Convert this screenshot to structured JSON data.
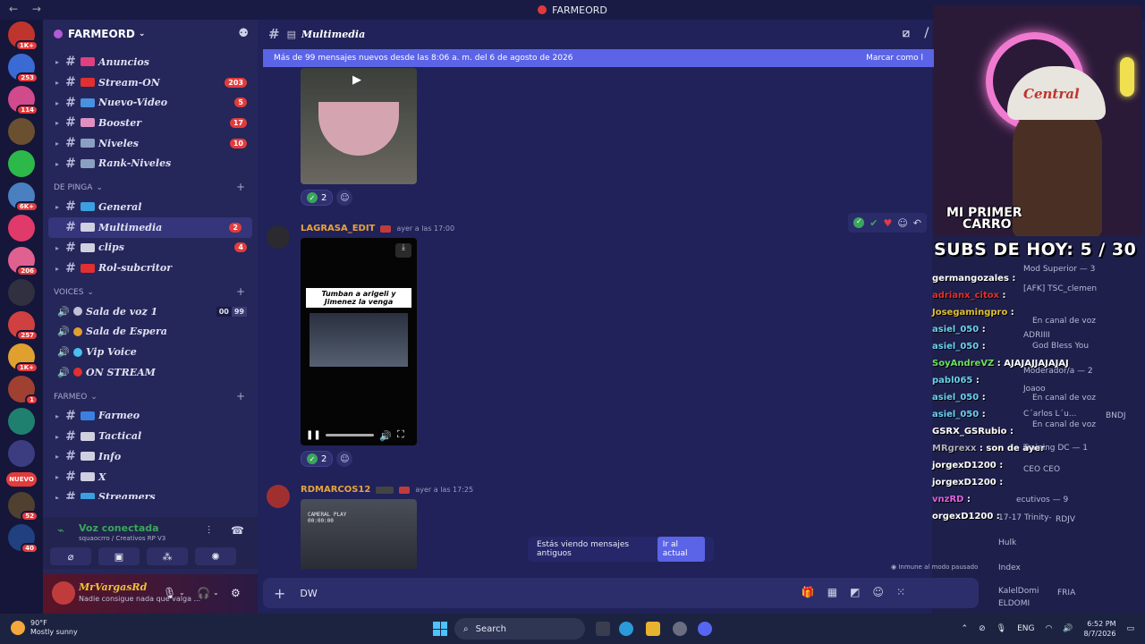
{
  "window": {
    "title": "FARMEORD"
  },
  "servers": [
    {
      "badge": "1K+",
      "color": "#c0342e"
    },
    {
      "badge": "253",
      "color": "#3a6ad4"
    },
    {
      "badge": "114",
      "color": "#d04a8c"
    },
    {
      "badge": "",
      "color": "#6a5030"
    },
    {
      "badge": "",
      "color": "#2db84a"
    },
    {
      "badge": "6K+",
      "color": "#4a80c0"
    },
    {
      "badge": "",
      "color": "#e03a6a"
    },
    {
      "badge": "206",
      "color": "#e06090"
    },
    {
      "badge": "",
      "color": "#303040"
    },
    {
      "badge": "257",
      "color": "#d04040"
    },
    {
      "badge": "1K+",
      "color": "#e0a030"
    },
    {
      "badge": "1",
      "color": "#a04030"
    },
    {
      "badge": "",
      "color": "#208070"
    },
    {
      "badge": "",
      "color": "#3c3d80"
    },
    {
      "badge": "52",
      "color": "#504030"
    },
    {
      "badge": "40",
      "color": "#204080"
    }
  ],
  "new_badge": "NUEVO",
  "guild": {
    "name": "FARMEORD"
  },
  "channels_top": [
    {
      "name": "Anuncios",
      "count": "",
      "emo": "#e04080"
    },
    {
      "name": "Stream-ON",
      "count": "203",
      "emo": "#e03030"
    },
    {
      "name": "Nuevo-Video",
      "count": "5",
      "emo": "#4a90e0"
    },
    {
      "name": "Booster",
      "count": "17",
      "emo": "#e090c0"
    },
    {
      "name": "Niveles",
      "count": "10",
      "emo": "#8aa0c0"
    },
    {
      "name": "Rank-Niveles",
      "count": "",
      "emo": "#8aa0c0"
    }
  ],
  "categories": {
    "de_pinga": "DE PINGA",
    "voices": "VOICES",
    "farmeo": "FARMEO"
  },
  "channels_pinga": [
    {
      "name": "General",
      "count": "",
      "emo": "#3aa0e0"
    },
    {
      "name": "Multimedia",
      "count": "2",
      "emo": "#d0d0e0"
    },
    {
      "name": "clips",
      "count": "4",
      "emo": "#d0d0e0"
    },
    {
      "name": "Rol-subcritor",
      "count": "",
      "emo": "#e03030"
    }
  ],
  "channels_voice": [
    {
      "name": "Sala de voz 1",
      "user_count": "00",
      "user_limit": "99"
    },
    {
      "name": "Sala de Espera"
    },
    {
      "name": "Vip Voice"
    },
    {
      "name": "ON STREAM"
    }
  ],
  "channels_farmeo": [
    {
      "name": "Farmeo",
      "emo": "#3a80e0"
    },
    {
      "name": "Tactical",
      "emo": "#d0d0e0"
    },
    {
      "name": "Info",
      "emo": "#d0d0e0"
    },
    {
      "name": "X",
      "emo": "#d0d0e0"
    },
    {
      "name": "Streamers",
      "emo": "#3aa0e0"
    }
  ],
  "voice_connected": {
    "title": "Voz conectada",
    "subtitle": "squaocrro / Creativos RP V3"
  },
  "user": {
    "name": "MrVargasRd",
    "status": "Nadie consigue nada que valga ..."
  },
  "channel_header": {
    "name": "Multimedia"
  },
  "new_messages_bar": {
    "text": "Más de 99 mensajes nuevos desde las 8:06 a. m. del 6 de agosto de 2026",
    "action": "Marcar como l"
  },
  "messages": [
    {
      "author": "",
      "reaction_count": "2"
    },
    {
      "author": "LAGRASA_EDIT",
      "time": "ayer a las 17:00",
      "video_caption": "Tumban a arigeli y Jimenez la venga",
      "reaction_count": "2"
    },
    {
      "author": "RDMARCOS12",
      "time": "ayer a las 17:25",
      "video_caption": "CAMERAL PLAY 00:00:00"
    }
  ],
  "old_messages_toast": {
    "text": "Estás viendo mensajes antiguos",
    "button": "Ir al actual"
  },
  "paused_note": "Inmune al modo pausado",
  "composer": {
    "value": "DW"
  },
  "stream_overlay": {
    "cap_text": "Central",
    "car_text_1": "MI PRIMER",
    "car_text_2": "CARRO",
    "subs_text": "SUBS DE HOY: 5 / 30"
  },
  "chat_lines": [
    {
      "user": "germangozales",
      "text": "",
      "color": "#ffffff"
    },
    {
      "user": "adrianx_citox",
      "text": "",
      "color": "#e03030"
    },
    {
      "user": "Josegamingpro",
      "text": "",
      "color": "#e0c030"
    },
    {
      "user": "asiel_050",
      "text": "",
      "color": "#6ad0f0"
    },
    {
      "user": "asiel_050",
      "text": "",
      "color": "#6ad0f0"
    },
    {
      "user": "SoyAndreVZ",
      "text": "AJAJAJJAJAJAJ",
      "color": "#6ae060"
    },
    {
      "user": "pabl065",
      "text": "",
      "color": "#6ad0f0"
    },
    {
      "user": "asiel_050",
      "text": "",
      "color": "#6ad0f0"
    },
    {
      "user": "asiel_050",
      "text": "",
      "color": "#6ad0f0"
    },
    {
      "user": "GSRX_GSRubio",
      "text": "",
      "color": "#ffffff"
    },
    {
      "user": "MRgrexx",
      "text": "son de ayer",
      "color": "#b0b0c0"
    },
    {
      "user": "jorgexD1200",
      "text": "",
      "color": "#ffffff"
    },
    {
      "user": "jorgexD1200",
      "text": "",
      "color": "#ffffff"
    },
    {
      "user": "vnzRD",
      "text": "",
      "color": "#e060e0"
    },
    {
      "user": "orgexD1200",
      "text": "",
      "color": "#ffffff"
    }
  ],
  "member_list": [
    {
      "label": "Mod Superior — 3"
    },
    {
      "label": "[AFK] TSC_clemen"
    },
    {
      "label": "En canal de voz"
    },
    {
      "label": "ADRIIII"
    },
    {
      "label": "God Bless You"
    },
    {
      "label": "Moderador/a — 2"
    },
    {
      "label": "Joaoo"
    },
    {
      "label": "En canal de voz"
    },
    {
      "label": "C´arlos L´u..."
    },
    {
      "label": "BNDJ"
    },
    {
      "label": "En canal de voz"
    },
    {
      "label": "Training DC — 1"
    },
    {
      "label": "CEO"
    },
    {
      "label": "CEO"
    },
    {
      "label": "ecutivos — 9"
    },
    {
      "label": "17-17 Trinity-"
    },
    {
      "label": "RDJV"
    },
    {
      "label": "Hulk"
    },
    {
      "label": "Index"
    },
    {
      "label": "KalelDomi"
    },
    {
      "label": "FRIA"
    },
    {
      "label": "ELDOMI"
    }
  ],
  "taskbar": {
    "temp": "90°F",
    "weather": "Mostly sunny",
    "search": "Search",
    "lang": "ENG",
    "time": "6:52 PM",
    "date": "8/7/2026"
  }
}
